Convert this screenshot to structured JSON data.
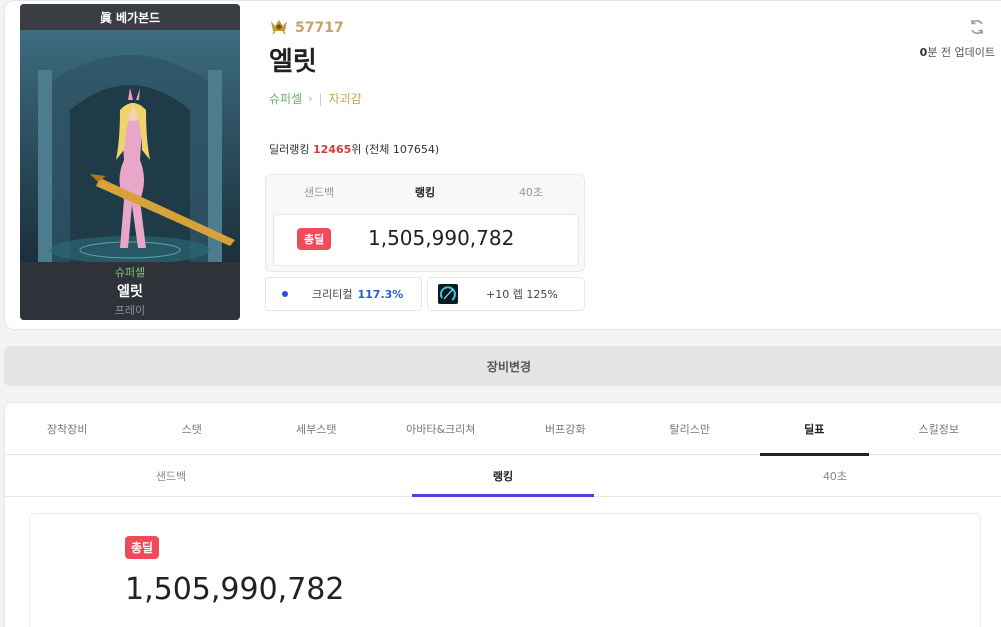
{
  "character": {
    "server": "眞 베가본드",
    "adventure": "슈퍼셀",
    "name": "엘릿",
    "job": "프레이"
  },
  "header": {
    "fame": "57717",
    "name": "엘릿",
    "adventure_link": "슈퍼셀",
    "guild": "자괴감",
    "update_minutes": "0",
    "update_suffix": "분 전 업데이트"
  },
  "ranking_line": {
    "prefix": "딜러랭킹 ",
    "rank": "12465",
    "suffix": "위 (전체 107654)"
  },
  "mini_panel": {
    "tabs": [
      "샌드백",
      "랭킹",
      "40초"
    ],
    "active_tab": 1,
    "badge": "총딜",
    "value": "1,505,990,782"
  },
  "stats": {
    "crit_label": "크리티컬",
    "crit_value": "117.3%",
    "weapon_text": "+10 렙 125%"
  },
  "equip_change_label": "장비변경",
  "main_tabs": [
    "장착장비",
    "스탯",
    "세부스탯",
    "아바타&크리쳐",
    "버프강화",
    "탈리스만",
    "딜표",
    "스킬정보"
  ],
  "main_active": 6,
  "sub_tabs": [
    "샌드백",
    "랭킹",
    "40초"
  ],
  "sub_active": 1,
  "result": {
    "badge": "총딜",
    "value": "1,505,990,782"
  },
  "colors": {
    "accent_red": "#ef4b5a",
    "accent_blue": "#2360d8",
    "tab_indicator": "#4b3fd9",
    "fame_gold": "#c6a36a",
    "adventure_green": "#6cb467"
  },
  "icons": [
    "fame-icon",
    "refresh-icon",
    "chevron-right-icon",
    "weapon-icon"
  ]
}
